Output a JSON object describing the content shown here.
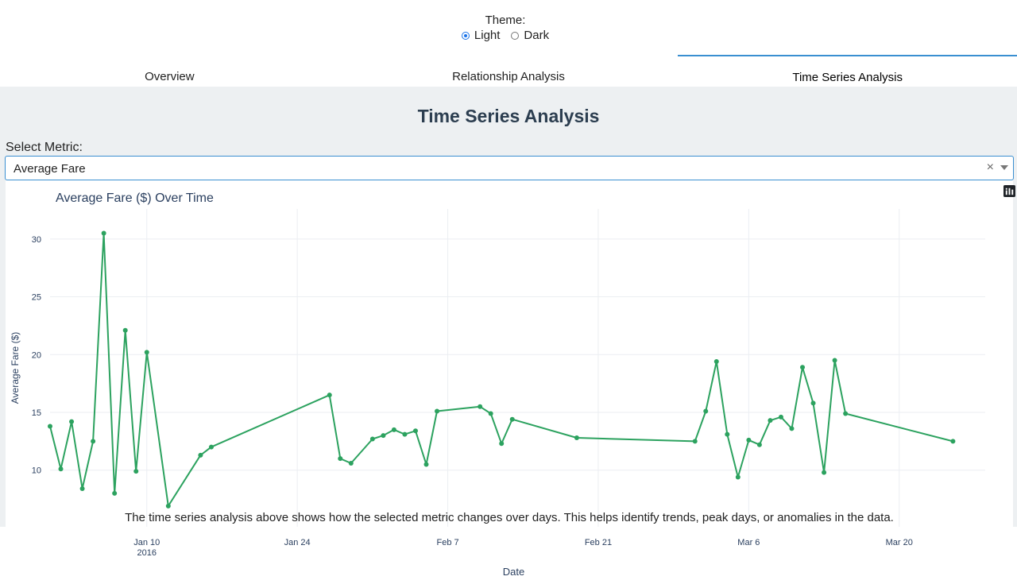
{
  "theme": {
    "label": "Theme:",
    "options": [
      {
        "label": "Light",
        "selected": true
      },
      {
        "label": "Dark",
        "selected": false
      }
    ]
  },
  "tabs": [
    {
      "label": "Overview"
    },
    {
      "label": "Relationship Analysis"
    },
    {
      "label": "Time Series Analysis",
      "active": true
    }
  ],
  "page": {
    "title": "Time Series Analysis",
    "select_label": "Select Metric:",
    "select_value": "Average Fare",
    "clear": "×"
  },
  "footer": "The time series analysis above shows how the selected metric changes over days. This helps identify trends, peak days, or anomalies in the data.",
  "modebar": [
    "camera-icon",
    "zoom-icon",
    "pan-icon",
    "box-select-icon",
    "lasso-icon",
    "zoom-in-icon",
    "zoom-out-icon",
    "autoscale-icon",
    "reset-axes-icon",
    "plotly-logo-icon"
  ],
  "chart_data": {
    "type": "line",
    "title": "Average Fare ($) Over Time",
    "xlabel": "Date",
    "ylabel": "Average Fare ($)",
    "line_color": "#2ca25f",
    "grid": true,
    "x_ticks": [
      {
        "date": "2016-01-10",
        "label": "Jan 10",
        "sub": "2016"
      },
      {
        "date": "2016-01-24",
        "label": "Jan 24"
      },
      {
        "date": "2016-02-07",
        "label": "Feb 7"
      },
      {
        "date": "2016-02-21",
        "label": "Feb 21"
      },
      {
        "date": "2016-03-06",
        "label": "Mar 6"
      },
      {
        "date": "2016-03-20",
        "label": "Mar 20"
      }
    ],
    "y_ticks": [
      10,
      15,
      20,
      25,
      30
    ],
    "ylim": [
      5.1,
      32.6
    ],
    "xlim": [
      "2016-01-01",
      "2016-03-28"
    ],
    "series": [
      {
        "x": [
          "2016-01-01",
          "2016-01-02",
          "2016-01-03",
          "2016-01-04",
          "2016-01-05",
          "2016-01-06",
          "2016-01-07",
          "2016-01-08",
          "2016-01-09",
          "2016-01-10",
          "2016-01-12",
          "2016-01-15",
          "2016-01-16",
          "2016-01-27",
          "2016-01-28",
          "2016-01-29",
          "2016-01-31",
          "2016-02-01",
          "2016-02-02",
          "2016-02-03",
          "2016-02-04",
          "2016-02-05",
          "2016-02-06",
          "2016-02-10",
          "2016-02-11",
          "2016-02-12",
          "2016-02-13",
          "2016-02-19",
          "2016-03-01",
          "2016-03-02",
          "2016-03-03",
          "2016-03-04",
          "2016-03-05",
          "2016-03-06",
          "2016-03-07",
          "2016-03-08",
          "2016-03-09",
          "2016-03-10",
          "2016-03-11",
          "2016-03-12",
          "2016-03-13",
          "2016-03-14",
          "2016-03-15",
          "2016-03-25"
        ],
        "y": [
          13.8,
          10.1,
          14.2,
          8.4,
          12.5,
          30.5,
          8.0,
          22.1,
          9.9,
          20.2,
          6.9,
          11.3,
          12.0,
          16.5,
          11.0,
          10.6,
          12.7,
          13.0,
          13.5,
          13.1,
          13.4,
          10.5,
          15.1,
          15.5,
          14.9,
          12.3,
          14.4,
          12.8,
          12.5,
          15.1,
          19.4,
          13.1,
          9.4,
          12.6,
          12.2,
          14.3,
          14.6,
          13.6,
          18.9,
          15.8,
          9.8,
          19.5,
          14.9,
          12.5
        ]
      }
    ]
  }
}
